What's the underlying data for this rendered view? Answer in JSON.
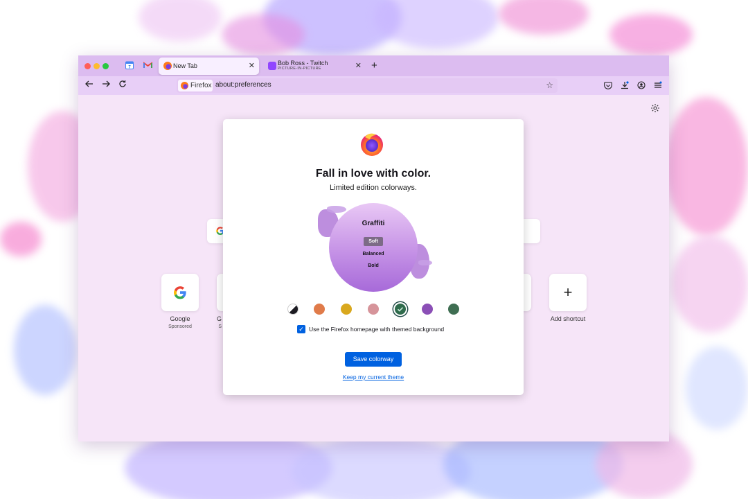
{
  "browser": {
    "tabs": [
      {
        "title": "New Tab",
        "active": true
      },
      {
        "title": "Bob Ross - Twitch",
        "subtitle": "PICTURE-IN-PICTURE",
        "active": false
      }
    ],
    "pinned_tabs": [
      "calendar-icon",
      "gmail-icon"
    ],
    "new_tab_symbol": "+",
    "close_symbol": "✕",
    "identity_label": "Firefox",
    "url": "about:preferences"
  },
  "newtab": {
    "shortcuts": [
      {
        "label": "Google",
        "sub": "Sponsored",
        "icon": "google-icon"
      },
      {
        "label": "G",
        "sub": "S"
      },
      {
        "label": "Add shortcut",
        "icon": "plus-icon",
        "symbol": "+"
      }
    ]
  },
  "modal": {
    "title": "Fall in love with color.",
    "subtitle": "Limited edition colorways.",
    "preview": {
      "name": "Graffiti",
      "options": [
        "Soft",
        "Balanced",
        "Bold"
      ],
      "selected": "Soft"
    },
    "swatches": [
      {
        "name": "default",
        "color": "#1c1b22",
        "selected": false
      },
      {
        "name": "orange",
        "color": "#e07b4a",
        "selected": false
      },
      {
        "name": "gold",
        "color": "#d9a81e",
        "selected": false
      },
      {
        "name": "pink",
        "color": "#d6949a",
        "selected": false
      },
      {
        "name": "green-selected",
        "color": "#2f6b4c",
        "selected": true
      },
      {
        "name": "purple",
        "color": "#8b4fb6",
        "selected": false
      },
      {
        "name": "forest",
        "color": "#3f6e52",
        "selected": false
      }
    ],
    "checkbox_label": "Use the Firefox homepage with themed background",
    "checkbox_checked": true,
    "save_button": "Save colorway",
    "keep_link": "Keep my current theme"
  },
  "colors": {
    "accent": "#0061e0",
    "tabstrip": "#dcbcf0",
    "toolbar": "#e8cff7",
    "content": "#f6e5f8"
  }
}
